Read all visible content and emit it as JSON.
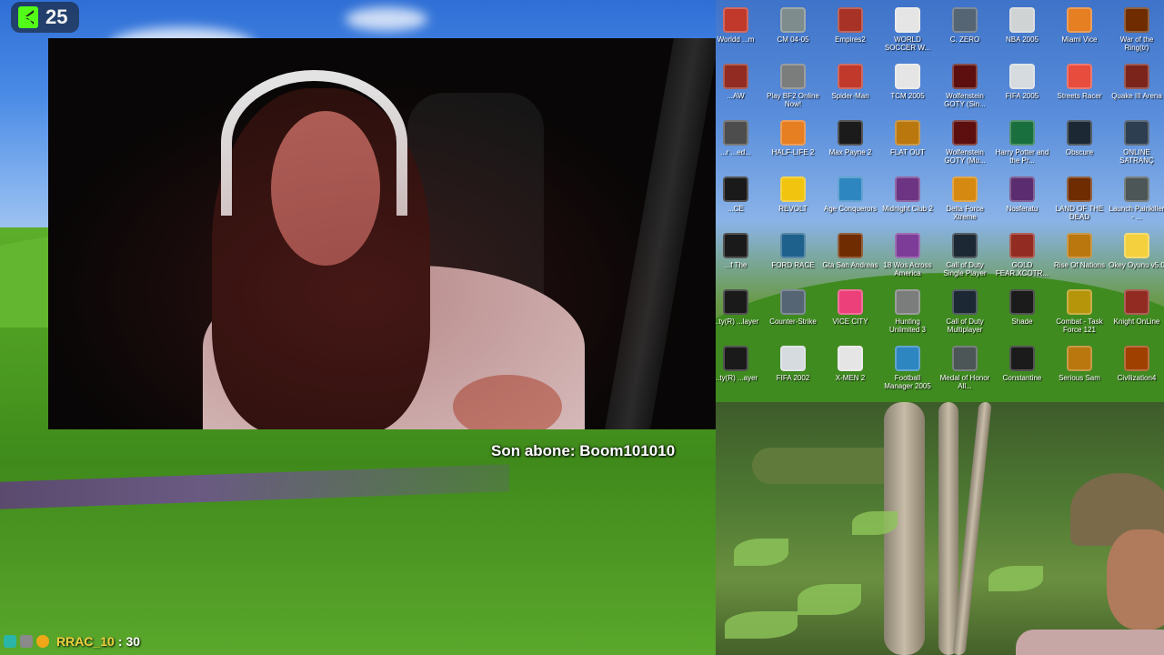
{
  "kick_badge": {
    "count": "25"
  },
  "subscriber_banner": {
    "text": "Son abone: Boom101010"
  },
  "chat": {
    "username": "RRAC_10",
    "separator": ":",
    "message": "30"
  },
  "desktop_icons": [
    {
      "label": "Worldd ...m",
      "color": "#c0392b"
    },
    {
      "label": "CM 04-05",
      "color": "#7f8c8d"
    },
    {
      "label": "Empires2",
      "color": "#a93226"
    },
    {
      "label": "WORLD SOCCER W...",
      "color": "#e5e5e5"
    },
    {
      "label": "C. ZERO",
      "color": "#566573"
    },
    {
      "label": "NBA 2005",
      "color": "#d0d3d4"
    },
    {
      "label": "Miami Vice",
      "color": "#e67e22"
    },
    {
      "label": "War of the Ring(tr)",
      "color": "#6e2c00"
    },
    {
      "label": "...AW",
      "color": "#922b21"
    },
    {
      "label": "Play BF2 Online Now!",
      "color": "#7b7d7d"
    },
    {
      "label": "Spider-Man",
      "color": "#c0392b"
    },
    {
      "label": "TCM 2005",
      "color": "#e5e5e5"
    },
    {
      "label": "Wolfenstein GOTY (Sin...",
      "color": "#5d0f0f"
    },
    {
      "label": "FIFA 2005",
      "color": "#d6dbdf"
    },
    {
      "label": "Streets Racer",
      "color": "#e74c3c"
    },
    {
      "label": "Quake III Arena",
      "color": "#7b241c"
    },
    {
      "label": "...r ...ed...",
      "color": "#4d4d4d"
    },
    {
      "label": "HALF-LIFE 2",
      "color": "#e67e22"
    },
    {
      "label": "Max Payne 2",
      "color": "#1b1b1b"
    },
    {
      "label": "FLAT OUT",
      "color": "#b9770e"
    },
    {
      "label": "Wolfenstein GOTY (Mu...",
      "color": "#5d0f0f"
    },
    {
      "label": "Harry Potter and the Pr...",
      "color": "#196f3d"
    },
    {
      "label": "Obscure",
      "color": "#1c2833"
    },
    {
      "label": "ONLINE SATRANÇ",
      "color": "#2c3e50"
    },
    {
      "label": "...CE",
      "color": "#1a1a1a"
    },
    {
      "label": "REVOLT",
      "color": "#f1c40f"
    },
    {
      "label": "Age Conquerors",
      "color": "#2e86c1"
    },
    {
      "label": "Midnight Club 2",
      "color": "#6c3483"
    },
    {
      "label": "Delta Force Xtreme",
      "color": "#d68910"
    },
    {
      "label": "Nosferatu",
      "color": "#5b2c6f"
    },
    {
      "label": "LAND OF THE DEAD",
      "color": "#6e2c00"
    },
    {
      "label": "Launch Painkiller - ...",
      "color": "#4d5656"
    },
    {
      "label": "...f The",
      "color": "#1a1a1a"
    },
    {
      "label": "FORD RACE",
      "color": "#1f618d"
    },
    {
      "label": "Gta San Andreas",
      "color": "#6e2c00"
    },
    {
      "label": "18 Wos Across America",
      "color": "#7d3c98"
    },
    {
      "label": "Call of Duty Single Player",
      "color": "#1c2833"
    },
    {
      "label": "GOLD FEAR.XCOTR...",
      "color": "#922b21"
    },
    {
      "label": "Rise Of Nations",
      "color": "#b9770e"
    },
    {
      "label": "Okey Oyunu v5.0",
      "color": "#f4d03f"
    },
    {
      "label": "...ty(R) ...layer",
      "color": "#1a1a1a"
    },
    {
      "label": "Counter-Strike",
      "color": "#566573"
    },
    {
      "label": "VICE CITY",
      "color": "#ec407a"
    },
    {
      "label": "Hunting Unlimited 3",
      "color": "#7b7d7d"
    },
    {
      "label": "Call of Duty Multiplayer",
      "color": "#1c2833"
    },
    {
      "label": "Shade",
      "color": "#1b1b1b"
    },
    {
      "label": "Combat - Task Force 121",
      "color": "#b7950b"
    },
    {
      "label": "Knight OnLine",
      "color": "#922b21"
    },
    {
      "label": "...ty(R) ...ayer",
      "color": "#1a1a1a"
    },
    {
      "label": "FIFA 2002",
      "color": "#d6dbdf"
    },
    {
      "label": "X-MEN 2",
      "color": "#e5e5e5"
    },
    {
      "label": "Football Manager 2005",
      "color": "#2e86c1"
    },
    {
      "label": "Medal of Honor All...",
      "color": "#4d5656"
    },
    {
      "label": "Constantine",
      "color": "#1b1b1b"
    },
    {
      "label": "Serious Sam",
      "color": "#b9770e"
    },
    {
      "label": "Civilization4",
      "color": "#a04000"
    }
  ]
}
